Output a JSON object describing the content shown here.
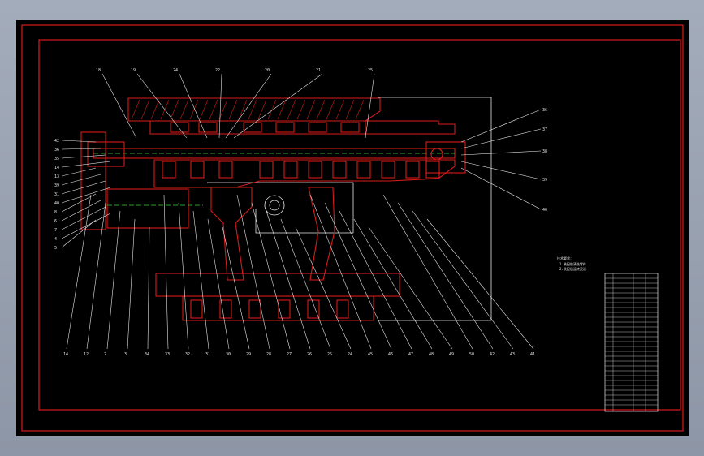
{
  "drawing": {
    "top_labels": [
      "18",
      "19",
      "24",
      "22",
      "20",
      "21",
      "25"
    ],
    "left_labels": [
      "42",
      "36",
      "35",
      "14",
      "13",
      "39",
      "31",
      "40",
      "8",
      "6",
      "7",
      "4",
      "5"
    ],
    "right_labels": [
      "36",
      "37",
      "38",
      "39",
      "40"
    ],
    "bottom_labels": [
      "14",
      "12",
      "2",
      "3",
      "34",
      "33",
      "32",
      "31",
      "30",
      "29",
      "28",
      "27",
      "26",
      "25",
      "24",
      "45",
      "46",
      "47",
      "48",
      "49",
      "50",
      "42",
      "43",
      "41"
    ],
    "notes": [
      "技术要求：",
      "1.装配前清洗零件",
      "2.装配后运转灵活"
    ],
    "colors": {
      "red": "#d81b1b",
      "white": "#e6e6e6",
      "green": "#33d633"
    }
  }
}
